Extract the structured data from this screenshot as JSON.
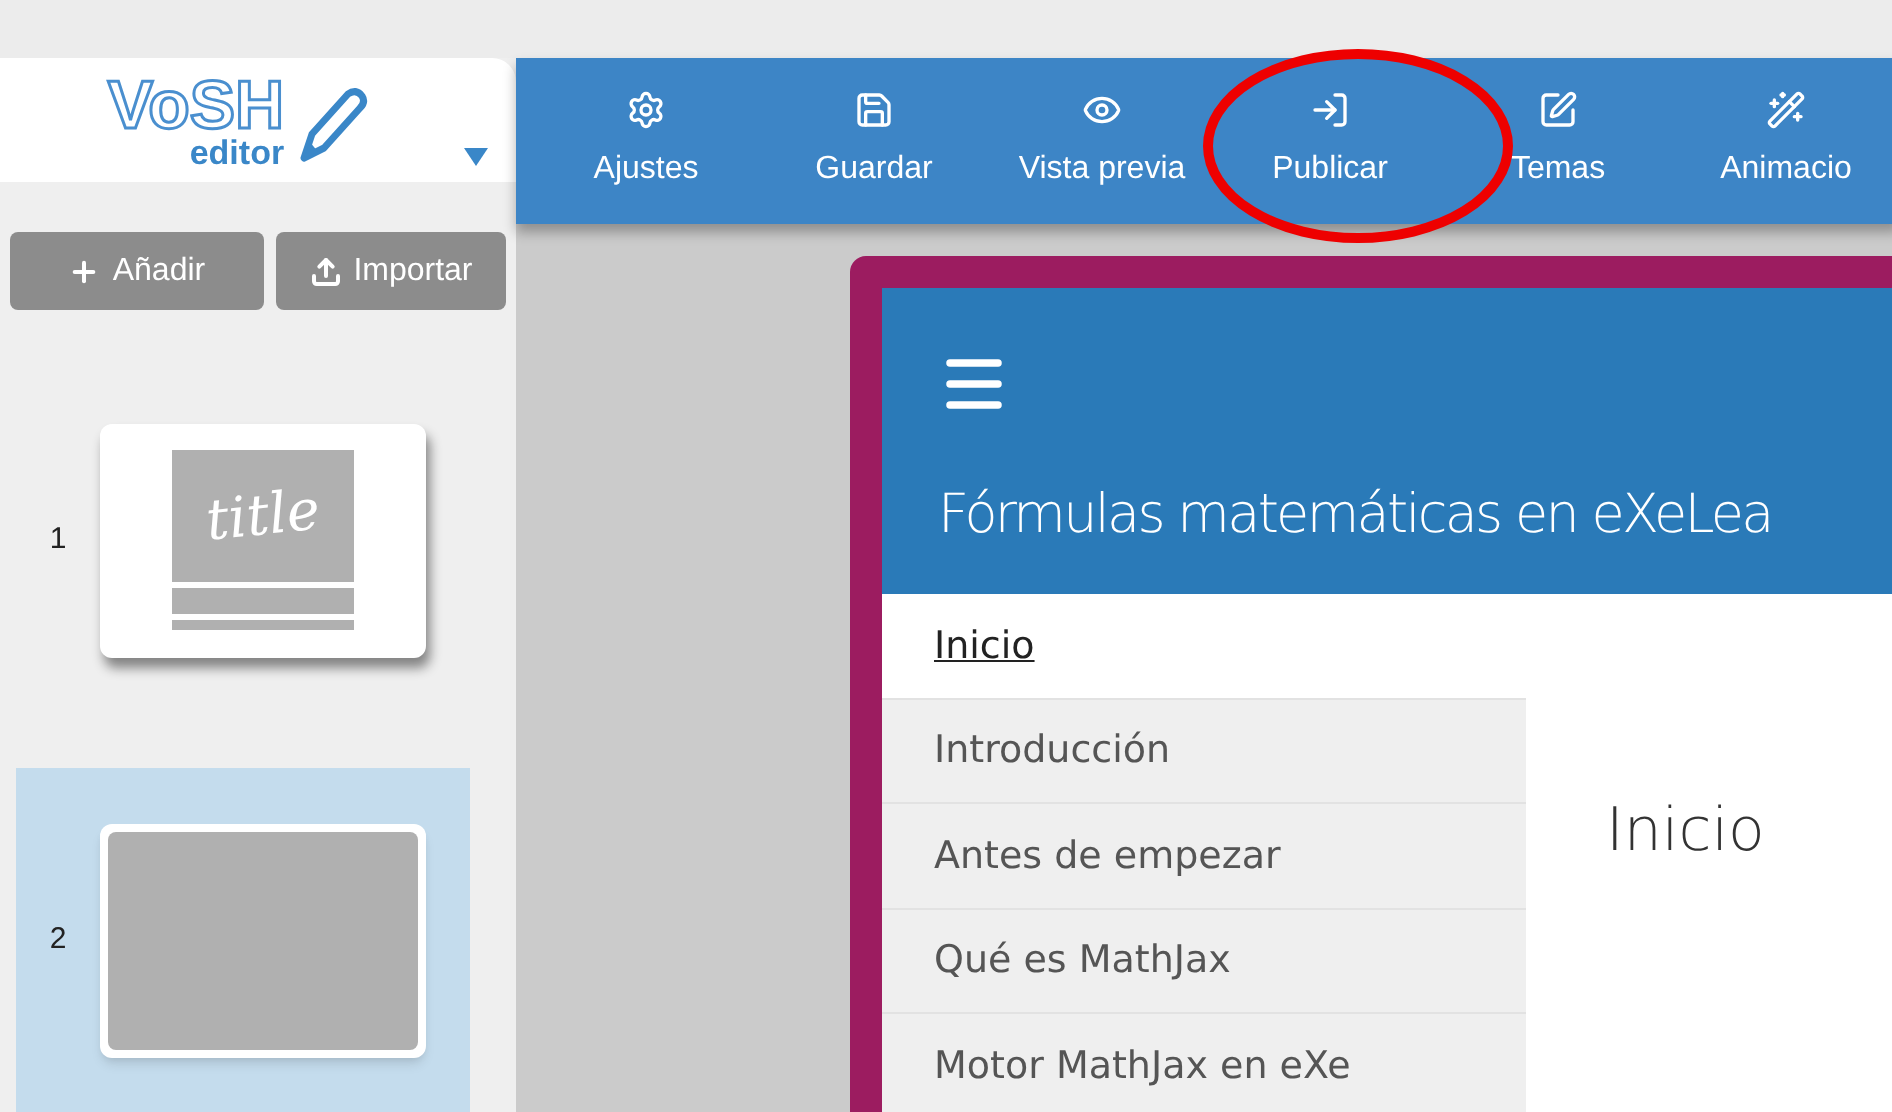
{
  "logo": {
    "mark": "VoSH",
    "sub": "editor"
  },
  "toolbar": [
    {
      "label": "Ajustes",
      "kind": "gear"
    },
    {
      "label": "Guardar",
      "kind": "save"
    },
    {
      "label": "Vista previa",
      "kind": "eye"
    },
    {
      "label": "Publicar",
      "kind": "publish"
    },
    {
      "label": "Temas",
      "kind": "edit"
    },
    {
      "label": "Animacio",
      "kind": "wand"
    }
  ],
  "sidebar": {
    "buttons": [
      {
        "label": "Añadir",
        "kind": "add"
      },
      {
        "label": "Importar",
        "kind": "import"
      }
    ],
    "slides": [
      {
        "number": "1",
        "kind": "title",
        "thumb_text": "title",
        "selected": false
      },
      {
        "number": "2",
        "kind": "blank",
        "selected": true
      }
    ]
  },
  "preview": {
    "title": "Fórmulas matemáticas en eXeLea",
    "nav": [
      {
        "label": "Inicio",
        "selected": true
      },
      {
        "label": "Introducción",
        "selected": false
      },
      {
        "label": "Antes de empezar",
        "selected": false
      },
      {
        "label": "Qué es MathJax",
        "selected": false
      },
      {
        "label": "Motor MathJax en eXe",
        "selected": false
      }
    ],
    "heading": "Inicio"
  },
  "annotation": {
    "kind": "ellipse"
  }
}
